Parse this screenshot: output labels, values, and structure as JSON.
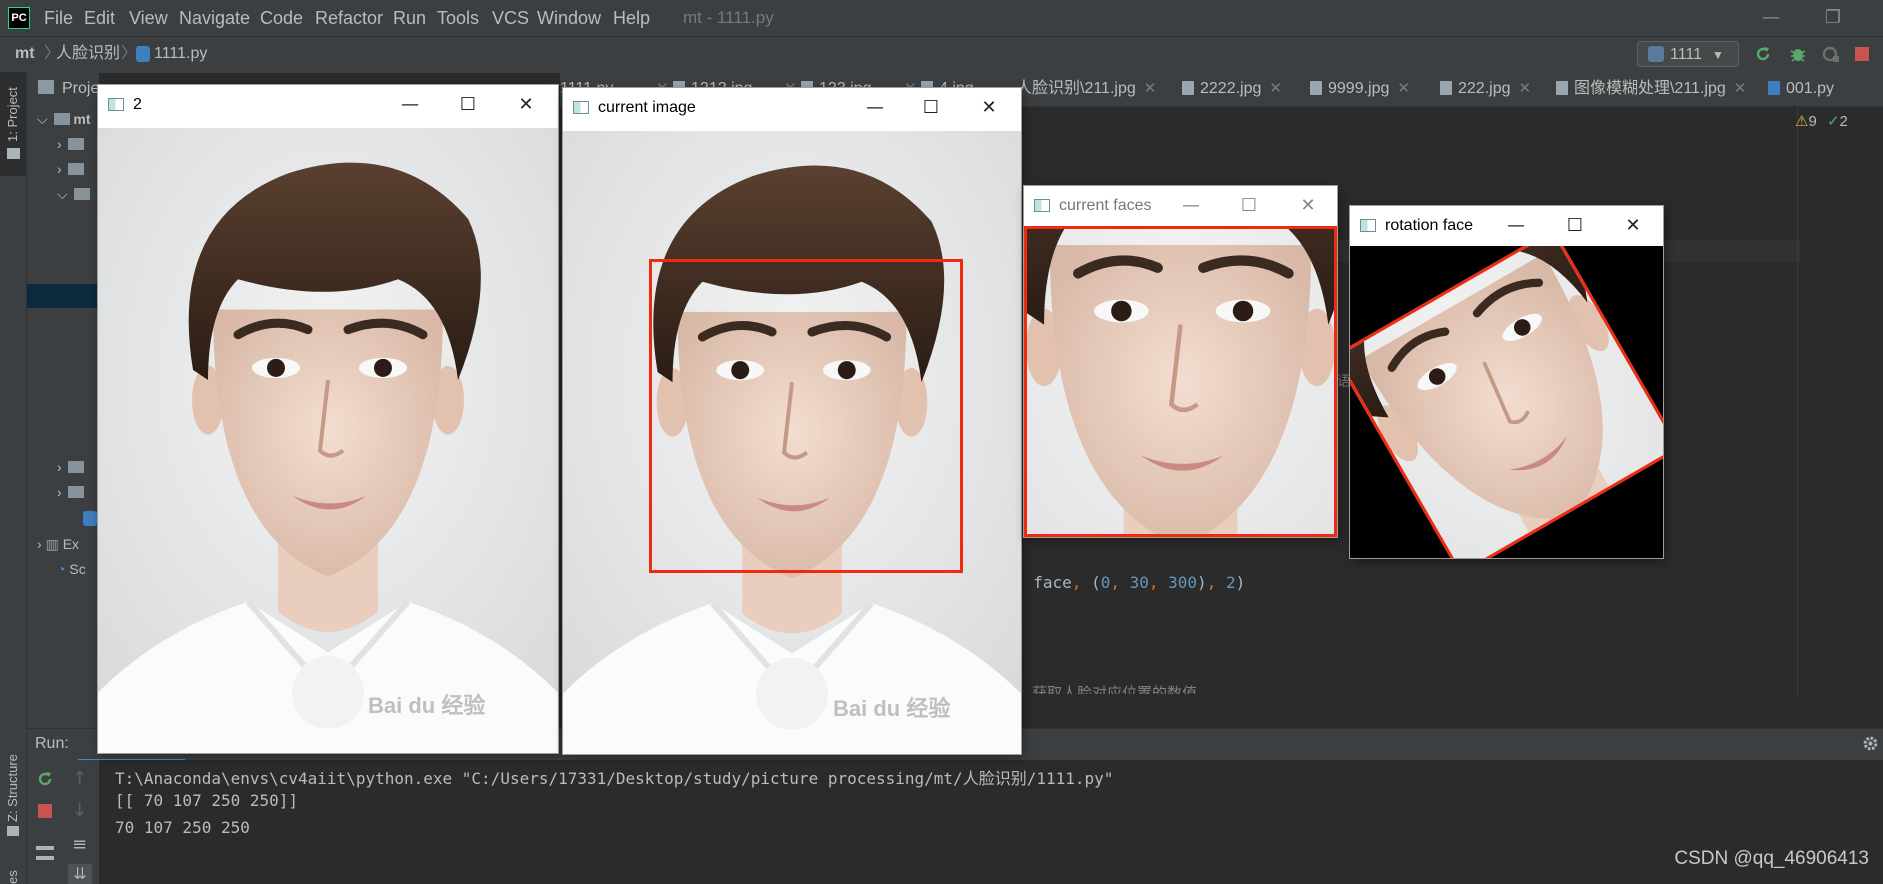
{
  "app": {
    "logo": "PC",
    "menu": [
      "File",
      "Edit",
      "View",
      "Navigate",
      "Code",
      "Refactor",
      "Run",
      "Tools",
      "VCS",
      "Window",
      "Help"
    ],
    "window_title": "mt - 1111.py",
    "controls": {
      "minimize": "—",
      "restore": "❐"
    }
  },
  "navbar": {
    "breadcrumb": [
      "mt",
      "人脸识别",
      "1111.py"
    ],
    "run_config": "1111"
  },
  "left_stripe": {
    "project_tab": "1: Project",
    "structure_tab": "Z: Structure",
    "favorites_tab": "es"
  },
  "project": {
    "header": "Proje",
    "rows": [
      "mt",
      "",
      "",
      "",
      "",
      "",
      "Ex",
      "Sc"
    ]
  },
  "editor": {
    "tabs": [
      "1111.py",
      "1212.jpg",
      "123.jpg",
      "4.jpg",
      "人脸识别\\211.jpg",
      "2222.jpg",
      "9999.jpg",
      "222.jpg",
      "图像模糊处理\\211.jpg",
      "001.py"
    ],
    "code_line_1": "face, (0, 30, 300), 2)",
    "code_line_2": "  获取人脸对应位置的数值",
    "margin_char": "语",
    "inspections": {
      "warnings": "9",
      "weak_warnings": "2"
    }
  },
  "run": {
    "label": "Run:",
    "console": [
      "T:\\Anaconda\\envs\\cv4aiit\\python.exe \"C:/Users/17331/Desktop/study/picture processing/mt/人脸识别/1111.py\"",
      "[[ 70 107 250 250]]",
      "70 107 250 250"
    ]
  },
  "watermark": "CSDN @qq_46906413",
  "cv_windows": [
    {
      "title": "2"
    },
    {
      "title": "current image"
    },
    {
      "title": "current faces"
    },
    {
      "title": "rotation face"
    }
  ],
  "cv_controls": {
    "minimize": "—",
    "maximize": "☐",
    "close": "✕"
  },
  "photo_watermark": "Bai du 经验",
  "colors": {
    "rectangle": "#ee2b10",
    "ide_bg": "#2b2b2b",
    "panel": "#3c3f41"
  }
}
